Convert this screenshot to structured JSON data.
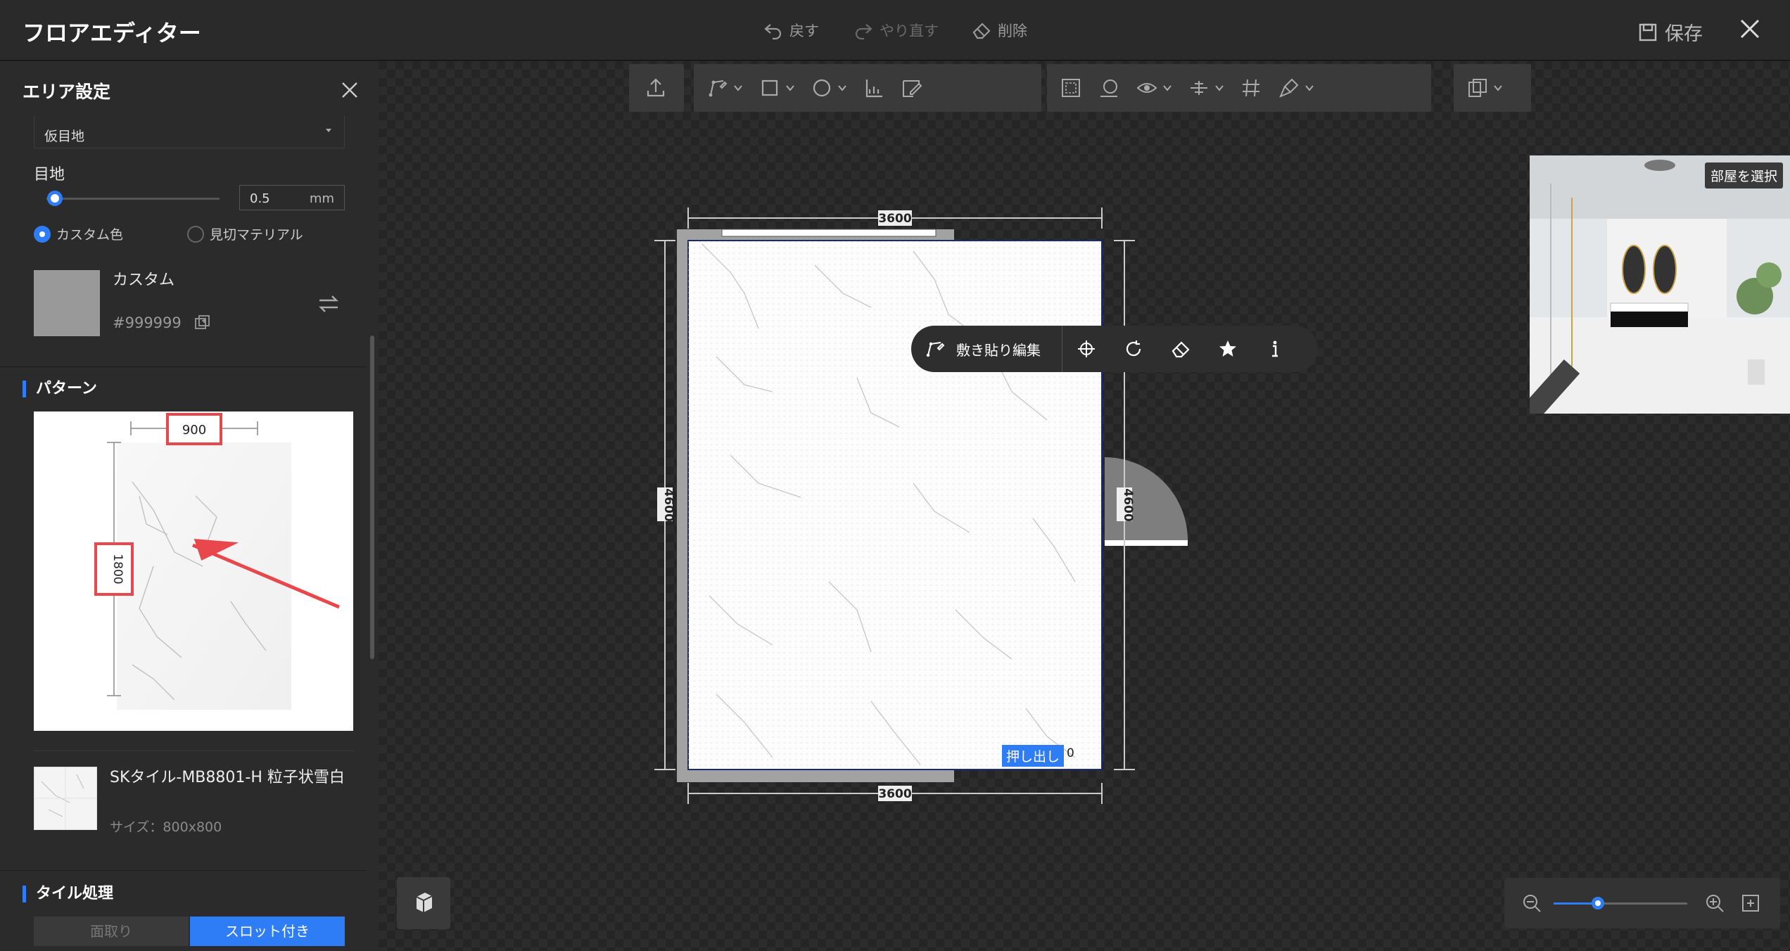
{
  "app": {
    "title": "フロアエディター",
    "undo_label": "戻す",
    "redo_label": "やり直す",
    "delete_label": "削除",
    "save_label": "保存"
  },
  "panel": {
    "title": "エリア設定",
    "grout_type": "仮目地",
    "joint_label": "目地",
    "joint_value": "0.5",
    "joint_unit": "mm",
    "joint_slider_fraction": 0.05,
    "radio_custom_color": "カスタム色",
    "radio_cut_material": "見切マテリアル",
    "color_name": "カスタム",
    "color_hex": "#999999",
    "pattern_section": "パターン",
    "pattern_width": "900",
    "pattern_height": "1800",
    "tile_name": "SKタイル-MB8801-H 粒子状雪白",
    "tile_size": "サイズ：800x800",
    "tile_processing_section": "タイル処理",
    "btn_chamfer": "面取り",
    "btn_slotted": "スロット付き"
  },
  "canvas": {
    "dim_top": "3600",
    "dim_bottom": "3600",
    "dim_left": "4600",
    "dim_right": "4600",
    "floating_edit_label": "敷き貼り編集",
    "extrude_label": "押し出し",
    "extrude_value": "0",
    "room_select_label": "部屋を選択",
    "zoom_fraction": 0.33
  },
  "colors": {
    "accent": "#2f7df6",
    "highlight_red": "#e8484b",
    "swatch": "#999999"
  },
  "icons": {
    "undo": "undo-icon",
    "redo": "redo-icon",
    "delete": "eraser-icon",
    "save": "save-icon",
    "close": "close-icon"
  }
}
